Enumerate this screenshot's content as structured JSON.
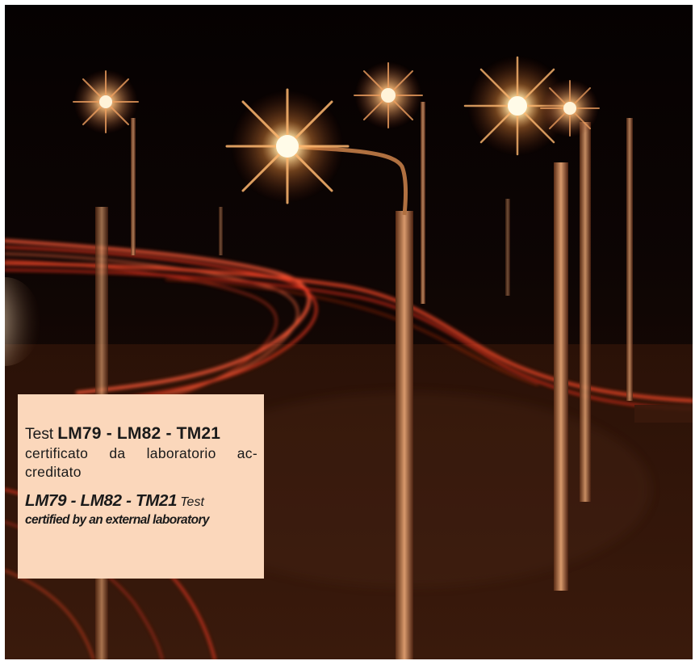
{
  "caption": {
    "it_word": "Test",
    "it_codes": "LM79 - LM82 - TM21",
    "it_body": "certificato da laboratorio ac-creditato",
    "en_codes": "LM79 - LM82 - TM21",
    "en_word": "Test",
    "en_body": "certified by an external laboratory"
  },
  "colors": {
    "caption_background": "#fbd7bb",
    "night_sky": "#0b0504",
    "light_trails": "#ff4a2a",
    "lamp_glow": "#ffe2a8"
  }
}
